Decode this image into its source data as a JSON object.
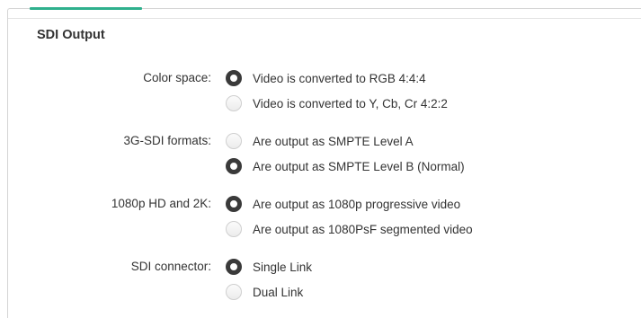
{
  "section": {
    "title": "SDI Output"
  },
  "settings": [
    {
      "label": "Color space:",
      "options": [
        {
          "label": "Video is converted to RGB 4:4:4",
          "selected": true
        },
        {
          "label": "Video is converted to Y, Cb, Cr 4:2:2",
          "selected": false
        }
      ]
    },
    {
      "label": "3G-SDI formats:",
      "options": [
        {
          "label": "Are output as SMPTE Level A",
          "selected": false
        },
        {
          "label": "Are output as SMPTE Level B (Normal)",
          "selected": true
        }
      ]
    },
    {
      "label": "1080p HD and 2K:",
      "options": [
        {
          "label": "Are output as 1080p progressive video",
          "selected": true
        },
        {
          "label": "Are output as 1080PsF segmented video",
          "selected": false
        }
      ]
    },
    {
      "label": "SDI connector:",
      "options": [
        {
          "label": "Single Link",
          "selected": true
        },
        {
          "label": "Dual Link",
          "selected": false
        }
      ]
    }
  ],
  "colors": {
    "accent": "#2fb08d",
    "radio_selected": "#3a3a3a",
    "text": "#333333"
  }
}
